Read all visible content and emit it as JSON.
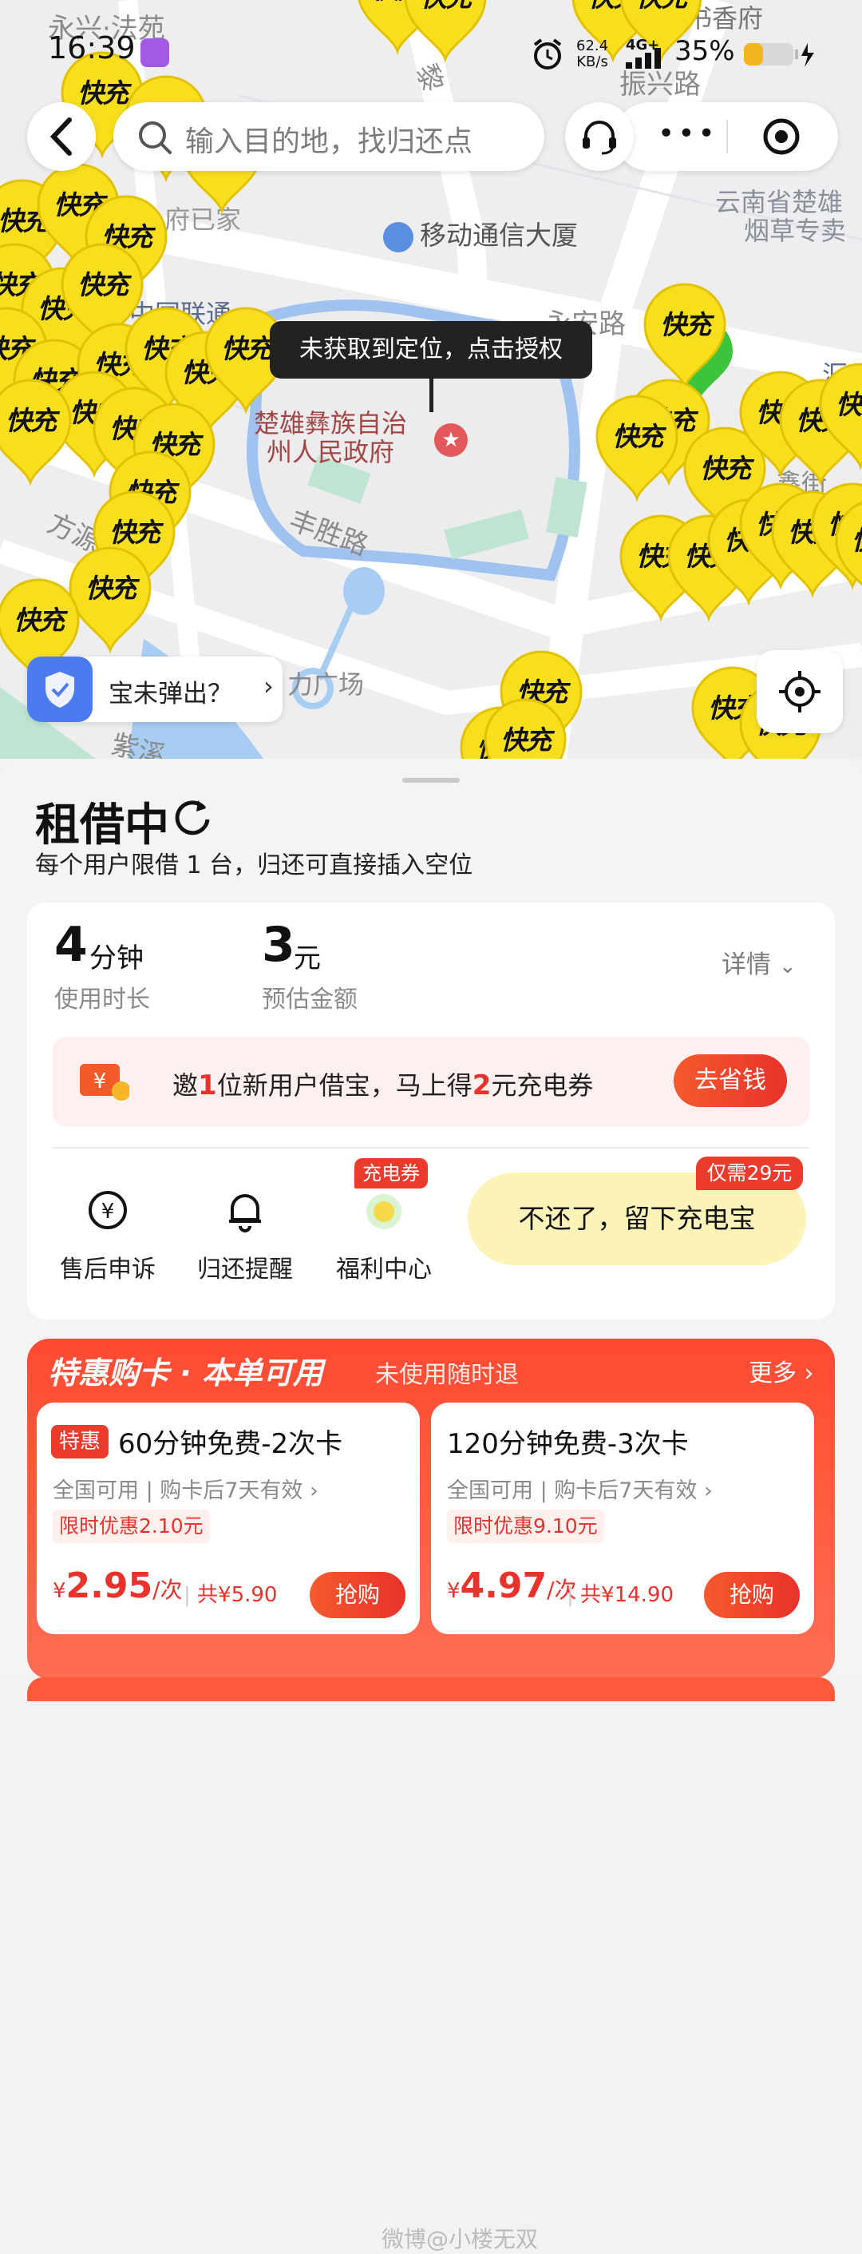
{
  "status_bar": {
    "location_overlay": "永兴·法苑",
    "time": "16:39",
    "speed": "62.4",
    "speed_unit": "KB/s",
    "network": "4G+",
    "battery_pct": "35%"
  },
  "search": {
    "placeholder": "输入目的地，找归还点"
  },
  "map": {
    "road_labels": [
      "振兴路",
      "永安路",
      "丰胜路",
      "方源",
      "黎",
      "紫溪"
    ],
    "poi_labels": [
      "移动通信大厦",
      "云南省楚雄",
      "烟草专卖",
      "中国联通",
      "府已家",
      "书香府",
      "汇",
      "力广场",
      "鑫街"
    ],
    "gov_label_line1": "楚雄彝族自治",
    "gov_label_line2": "州人民政府",
    "tooltip": "未获取到定位，点击授权",
    "bao_prompt": "宝未弹出？",
    "marker_text": "快充"
  },
  "sheet": {
    "title": "租借中",
    "subtitle": "每个用户限借 1 台，归还可直接插入空位",
    "duration_value": "4",
    "duration_unit": "分钟",
    "duration_label": "使用时长",
    "fee_value": "3",
    "fee_unit": "元",
    "fee_label": "预估金额",
    "detail_label": "详情",
    "invite_pre": "邀",
    "invite_num1": "1",
    "invite_mid": "位新用户借宝，马上得",
    "invite_num2": "2",
    "invite_post": "元充电券",
    "invite_btn": "去省钱",
    "actions": [
      {
        "label": "售后申诉"
      },
      {
        "label": "归还提醒"
      },
      {
        "label": "福利中心",
        "badge": "充电券"
      }
    ],
    "keep_btn": "不还了，留下充电宝",
    "keep_badge": "仅需29元"
  },
  "promo": {
    "title": "特惠购卡 · 本单可用",
    "subtitle": "未使用随时退",
    "more": "更多",
    "cards": [
      {
        "tag": "特惠",
        "name": "60分钟免费-2次卡",
        "meta": "全国可用 | 购卡后7天有效",
        "limit": "限时优惠2.10元",
        "price_prefix": "¥",
        "price": "2.95",
        "price_unit": "/次",
        "total": "共¥5.90",
        "buy": "抢购"
      },
      {
        "name": "120分钟免费-3次卡",
        "meta": "全国可用 | 购卡后7天有效",
        "limit": "限时优惠9.10元",
        "price_prefix": "¥",
        "price": "4.97",
        "price_unit": "/次",
        "total": "共¥14.90",
        "buy": "抢购"
      }
    ]
  },
  "watermark": "微博@小楼无双",
  "colors": {
    "accent_red": "#e8322b",
    "marker_yellow": "#f7df1e",
    "promo_bg": "#ff4a33",
    "keep_btn_bg": "#fbf3b8"
  }
}
